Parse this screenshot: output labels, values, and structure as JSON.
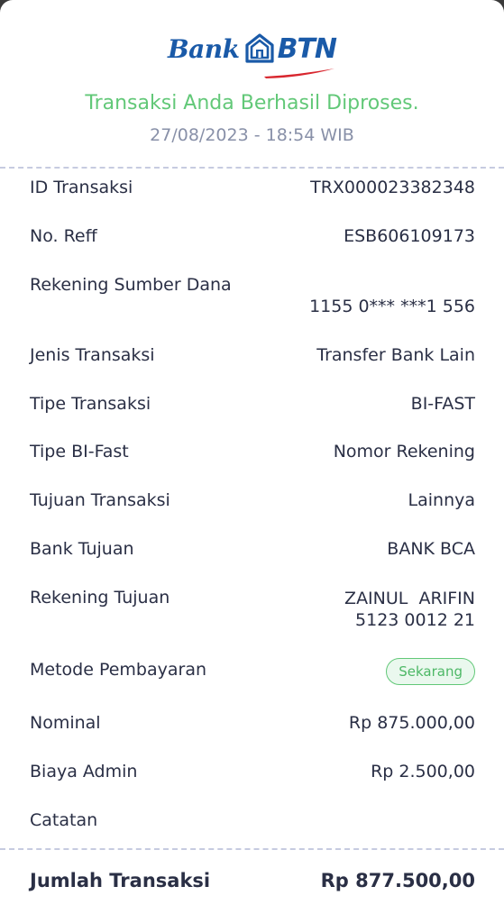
{
  "header": {
    "logo_text_bank": "Bank",
    "logo_text_btn": "BTN",
    "status_message": "Transaksi Anda Berhasil Diproses.",
    "datetime": "27/08/2023 - 18:54 WIB"
  },
  "details": {
    "id_transaksi": {
      "label": "ID Transaksi",
      "value": "TRX000023382348"
    },
    "no_reff": {
      "label": "No. Reff",
      "value": "ESB606109173"
    },
    "rekening_sumber": {
      "label": "Rekening Sumber Dana",
      "value": "1155 0*** ***1 556"
    },
    "jenis_transaksi": {
      "label": "Jenis Transaksi",
      "value": "Transfer Bank Lain"
    },
    "tipe_transaksi": {
      "label": "Tipe Transaksi",
      "value": "BI-FAST"
    },
    "tipe_bifast": {
      "label": "Tipe BI-Fast",
      "value": "Nomor Rekening"
    },
    "tujuan_transaksi": {
      "label": "Tujuan Transaksi",
      "value": "Lainnya"
    },
    "bank_tujuan": {
      "label": "Bank Tujuan",
      "value": "BANK BCA"
    },
    "rekening_tujuan": {
      "label": "Rekening Tujuan",
      "name": "ZAINUL  ARIFIN",
      "number": "5123 0012 21"
    },
    "metode_pembayaran": {
      "label": "Metode Pembayaran",
      "value": "Sekarang"
    },
    "nominal": {
      "label": "Nominal",
      "value": "Rp 875.000,00"
    },
    "biaya_admin": {
      "label": "Biaya Admin",
      "value": "Rp 2.500,00"
    },
    "catatan": {
      "label": "Catatan",
      "value": ""
    }
  },
  "total": {
    "label": "Jumlah Transaksi",
    "value": "Rp 877.500,00"
  },
  "colors": {
    "brand_blue": "#1a5aa8",
    "brand_red": "#d8262e",
    "success_green": "#62c878",
    "text_dark": "#2a2f45",
    "text_muted": "#8890a8"
  }
}
